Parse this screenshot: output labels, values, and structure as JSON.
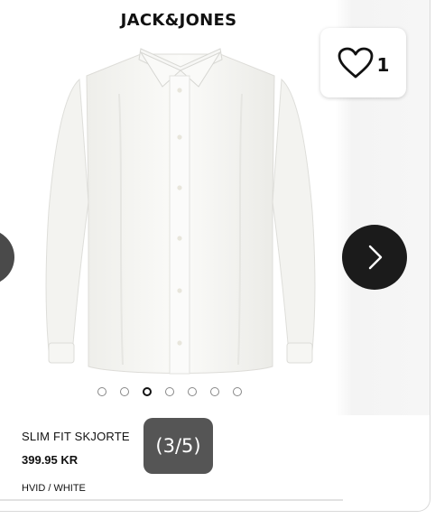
{
  "brand": "JACK&JONES",
  "favorite": {
    "icon": "heart-outline-icon",
    "count": "1"
  },
  "carousel": {
    "current": 3,
    "total": 5,
    "counter_text": "(3/5)",
    "dot_count": 7,
    "active_dot": 2,
    "prev_icon": "chevron-left-icon",
    "next_icon": "chevron-right-icon"
  },
  "product": {
    "name": "SLIM FIT SKJORTE",
    "price": "399.95 KR",
    "color": "HVID / WHITE"
  },
  "colors": {
    "nav_dark": "#1b1b1b",
    "nav_grey": "#4a4a4a",
    "counter_bg": "#555555"
  }
}
